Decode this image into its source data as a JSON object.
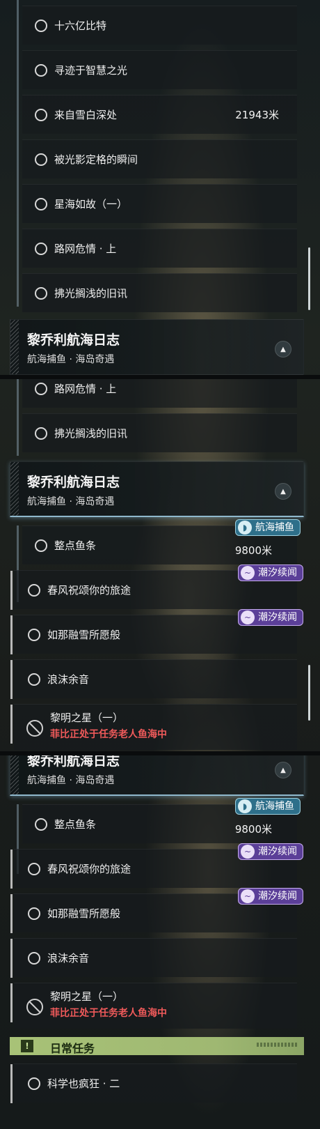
{
  "sec1": {
    "items": [
      {
        "label": "十六亿比特"
      },
      {
        "label": "寻迹于智慧之光"
      },
      {
        "label": "来自雪白深处",
        "distance": "21943米"
      },
      {
        "label": "被光影定格的瞬间"
      },
      {
        "label": "星海如故（一）"
      },
      {
        "label": "路网危情 · 上"
      },
      {
        "label": "拂光搁浅的旧讯"
      }
    ],
    "header": {
      "title": "黎乔利航海日志",
      "subtitle": "航海捕鱼 · 海岛奇遇"
    }
  },
  "sec2": {
    "items_top": [
      {
        "label": "路网危情 · 上"
      },
      {
        "label": "拂光搁浅的旧讯"
      }
    ],
    "header": {
      "title": "黎乔利航海日志",
      "subtitle": "航海捕鱼 · 海岛奇遇"
    },
    "quests": [
      {
        "label": "整点鱼条",
        "distance": "9800米",
        "badge": "航海捕鱼"
      },
      {
        "label": "春风祝颂你的旅途",
        "badge": "潮汐续闻"
      },
      {
        "label": "如那融雪所愿般",
        "badge": "潮汐续闻"
      },
      {
        "label": "浪沫余音"
      }
    ],
    "blocked": {
      "label": "黎明之星（一）",
      "status": "菲比正处于任务老人鱼海中"
    }
  },
  "sec3": {
    "header": {
      "title": "黎乔利航海日志",
      "subtitle": "航海捕鱼 · 海岛奇遇"
    },
    "quests": [
      {
        "label": "整点鱼条",
        "distance": "9800米",
        "badge": "航海捕鱼"
      },
      {
        "label": "春风祝颂你的旅途",
        "badge": "潮汐续闻"
      },
      {
        "label": "如那融雪所愿般",
        "badge": "潮汐续闻"
      },
      {
        "label": "浪沫余音"
      }
    ],
    "blocked": {
      "label": "黎明之星（一）",
      "status": "菲比正处于任务老人鱼海中"
    },
    "daily": {
      "title": "日常任务",
      "icon": "!"
    },
    "daily_item": {
      "label": "科学也疯狂 · 二"
    }
  },
  "icons": {
    "collapse": "▲",
    "fish_badge": "fish-icon",
    "tide_badge": "wave-icon"
  },
  "colors": {
    "daily_bar": "#a8c277",
    "fish_badge": "#2e6f8a",
    "tide_badge": "#5b3f98",
    "blocked_text": "#ef5a5a"
  }
}
